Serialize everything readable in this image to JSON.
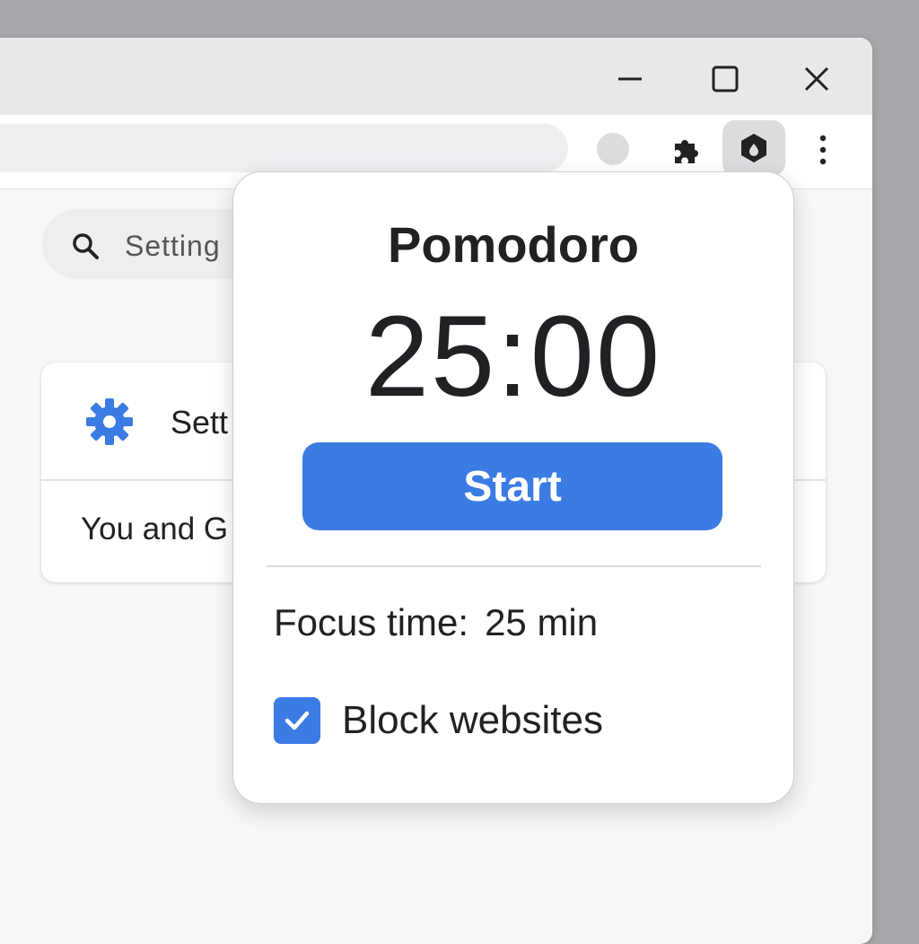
{
  "window": {
    "controls": {
      "minimize_icon": "minimize-icon",
      "maximize_icon": "maximize-icon",
      "close_icon": "close-icon"
    }
  },
  "toolbar": {
    "extensions_icon": "puzzle-icon",
    "active_extension_icon": "shield-icon",
    "menu_icon": "vertical-dots-icon"
  },
  "settings_page": {
    "search_placeholder": "Setting",
    "card_title": "Sett",
    "card_subitem": "You and G"
  },
  "popup": {
    "title": "Pomodoro",
    "timer": "25:00",
    "start_label": "Start",
    "focus_label": "Focus time:",
    "focus_value": "25 min",
    "block_label": "Block websites",
    "block_checked": true
  },
  "colors": {
    "accent": "#3b7be4",
    "text": "#202124"
  }
}
